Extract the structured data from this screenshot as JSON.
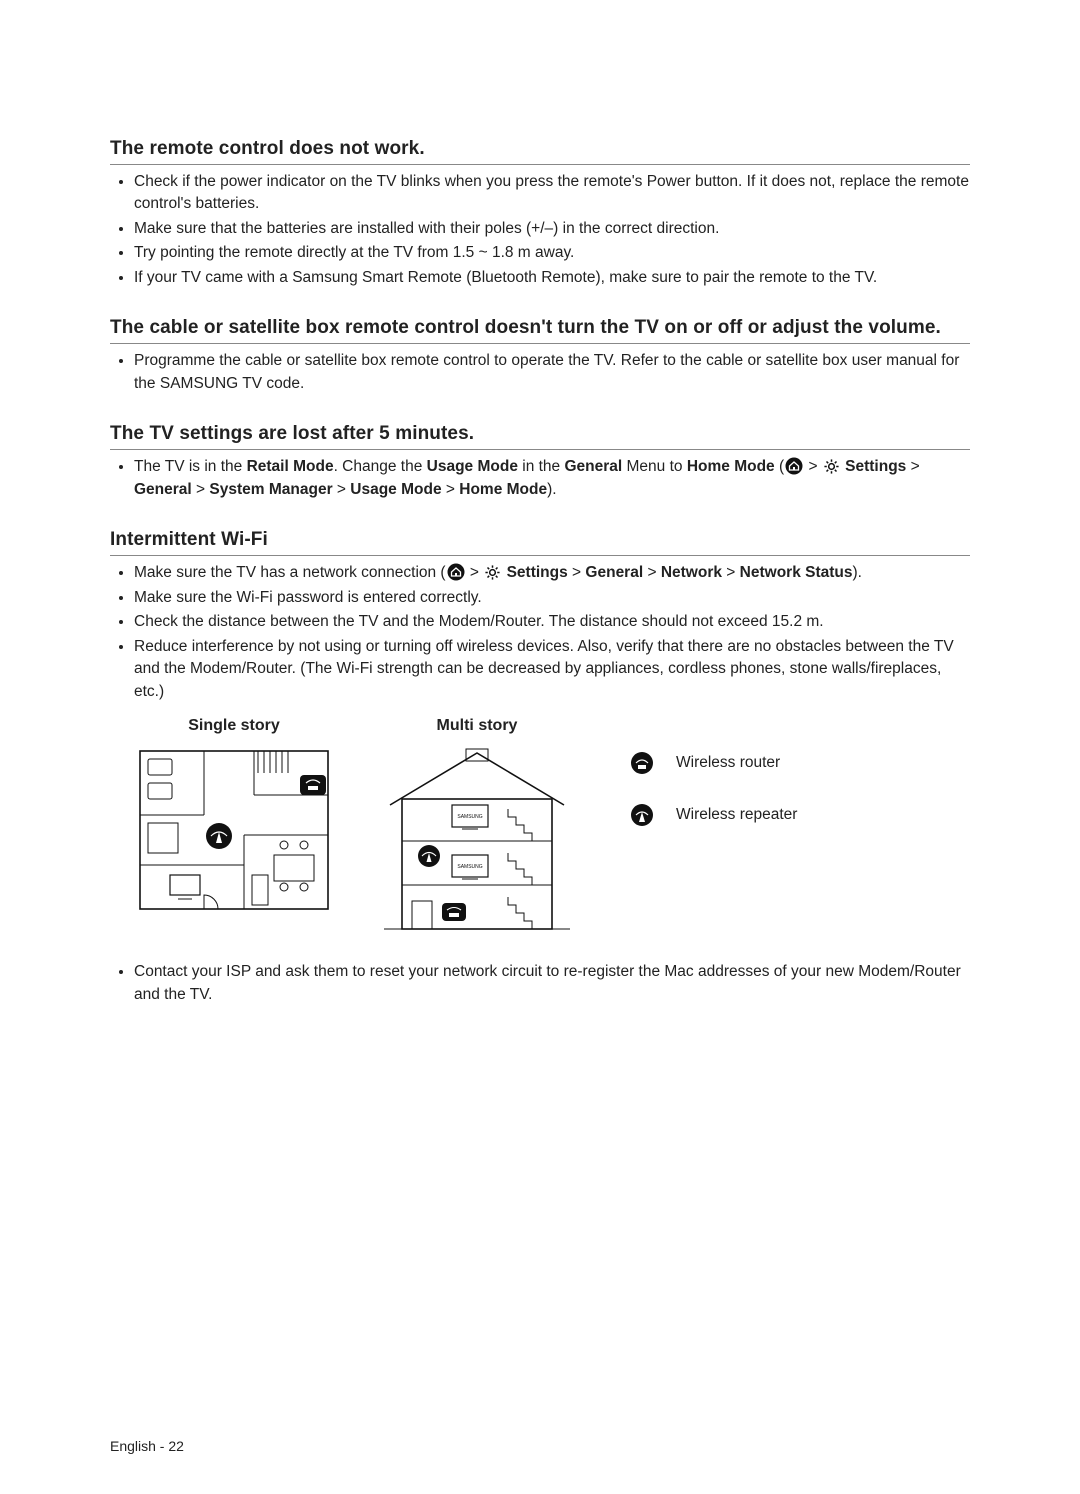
{
  "sections": [
    {
      "title": "The remote control does not work.",
      "bullets": [
        "Check if the power indicator on the TV blinks when you press the remote's Power button. If it does not, replace the remote control's batteries.",
        "Make sure that the batteries are installed with their poles (+/–) in the correct direction.",
        "Try pointing the remote directly at the TV from 1.5 ~ 1.8 m away.",
        "If your TV came with a Samsung Smart Remote (Bluetooth Remote), make sure to pair the remote to the TV."
      ]
    },
    {
      "title": "The cable or satellite box remote control doesn't turn the TV on or off or adjust the volume.",
      "bullets": [
        "Programme the cable or satellite box remote control to operate the TV. Refer to the cable or satellite box user manual for the SAMSUNG TV code."
      ]
    },
    {
      "title": "The TV settings are lost after 5 minutes."
    },
    {
      "title": "Intermittent Wi-Fi"
    }
  ],
  "retail_mode": {
    "pre": "The TV is in the ",
    "b1": "Retail Mode",
    "mid1": ". Change the ",
    "b2": "Usage Mode",
    "mid2": " in the ",
    "b3": "General",
    "mid3": " Menu to ",
    "b4": "Home Mode",
    "open": " (",
    "sep": " > ",
    "settings": "Settings",
    "general": "General",
    "sys": "System Manager",
    "usage": "Usage Mode",
    "home": "Home Mode",
    "close": ")."
  },
  "wifi": {
    "line1_pre": "Make sure the TV has a network connection (",
    "settings": "Settings",
    "general": "General",
    "network": "Network",
    "status": "Network Status",
    "line1_post": ").",
    "line2": "Make sure the Wi-Fi password is entered correctly.",
    "line3": "Check the distance between the TV and the Modem/Router. The distance should not exceed 15.2 m.",
    "line4": "Reduce interference by not using or turning off wireless devices. Also, verify that there are no obstacles between the TV and the Modem/Router. (The Wi-Fi strength can be decreased by appliances, cordless phones, stone walls/fireplaces, etc.)",
    "line5": "Contact your ISP and ask them to reset your network circuit to re-register the Mac addresses of your new Modem/Router and the TV."
  },
  "diagram": {
    "single": "Single story",
    "multi": "Multi story",
    "router": "Wireless router",
    "repeater": "Wireless repeater"
  },
  "footer": {
    "lang": "English",
    "dash": " - ",
    "page": "22"
  }
}
